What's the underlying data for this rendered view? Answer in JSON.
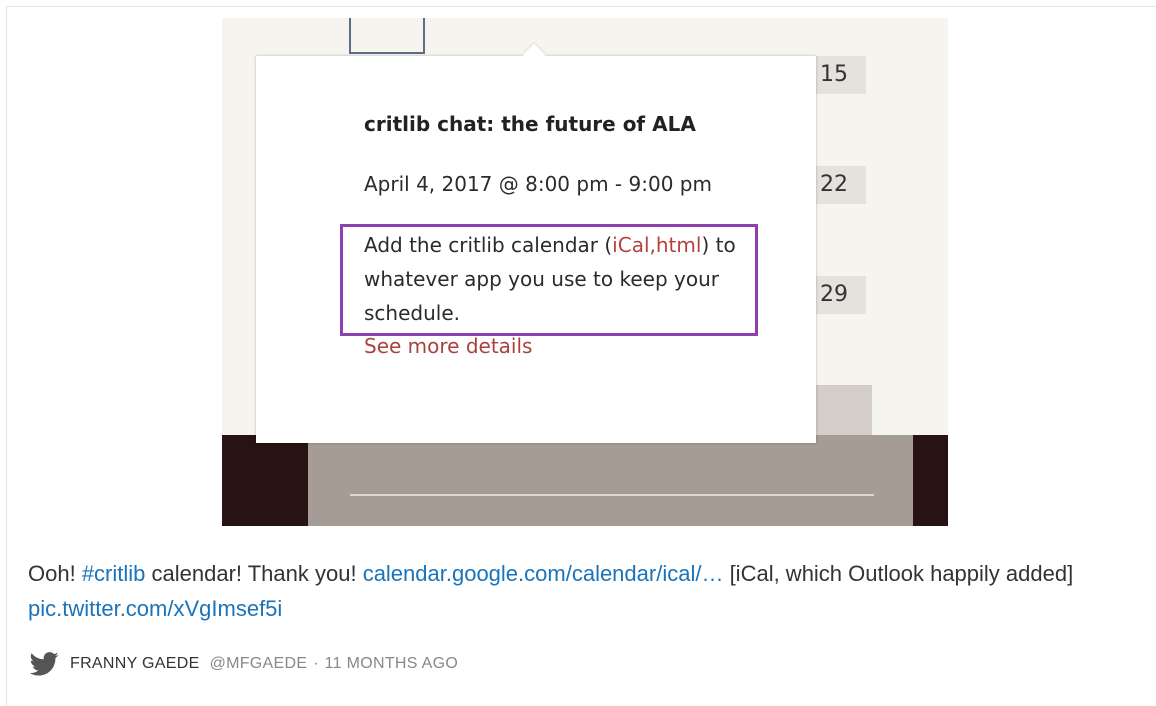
{
  "media": {
    "days": [
      "15",
      "22",
      "29"
    ],
    "popup": {
      "title": "critlib chat: the future of ALA",
      "date": "April 4, 2017 @ 8:00 pm - 9:00 pm",
      "desc_before": "Add the critlib calendar (",
      "desc_ical": "iCal",
      "desc_comma": ",",
      "desc_html": "html",
      "desc_after": ") to whatever app you use to keep your schedule.",
      "more_link": "See more details"
    }
  },
  "tweet": {
    "text_1": "Ooh! ",
    "hashtag": "#critlib",
    "text_2": " calendar! Thank you! ",
    "link_1": "calendar.google.com/calendar/ical/…",
    "text_3": " [iCal, which Outlook happily added] ",
    "link_2": "pic.twitter.com/xVgImsef5i"
  },
  "meta": {
    "icon": "twitter-bird-icon",
    "author": "FRANNY GAEDE",
    "handle": "@MFGAEDE",
    "separator": "·",
    "time": "11 MONTHS AGO"
  },
  "colors": {
    "link": "#1b73b9",
    "highlight_box": "#8e3fb0",
    "popup_link": "#b5433c",
    "twitter_icon": "#555555"
  }
}
